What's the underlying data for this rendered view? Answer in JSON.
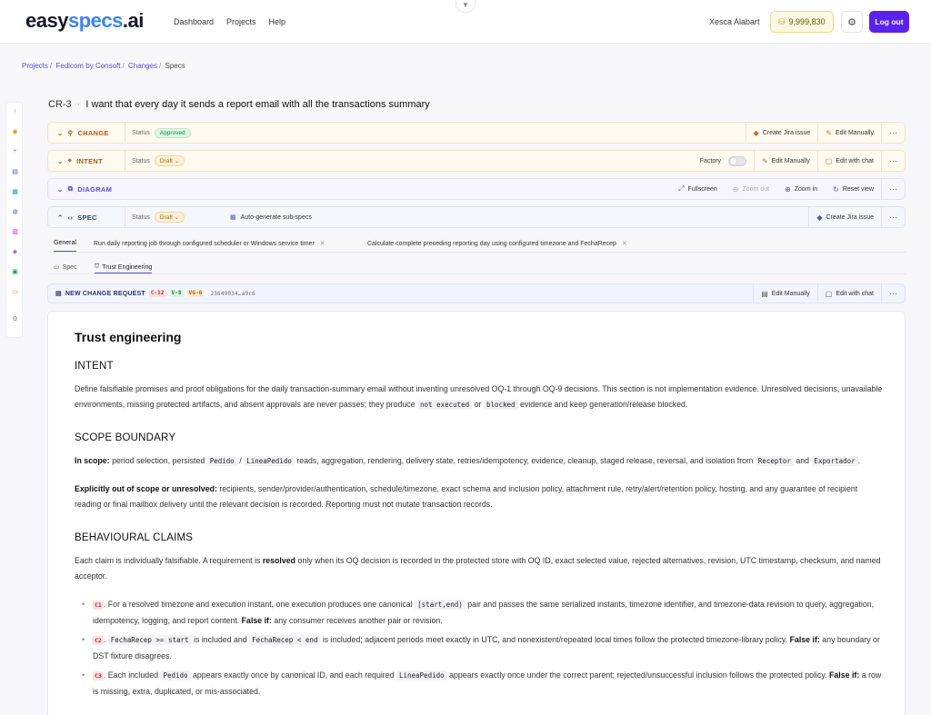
{
  "brand": {
    "part1": "easy",
    "part2": "specs",
    "part3": ".ai"
  },
  "nav": {
    "dashboard": "Dashboard",
    "projects": "Projects",
    "help": "Help"
  },
  "user": {
    "name": "Xesca Alabart",
    "credits": "9,999,830",
    "logout": "Log out"
  },
  "breadcrumb": {
    "projects": "Projects",
    "project": "Fedicom by Consoft",
    "changes": "Changes",
    "current": "Specs"
  },
  "title": {
    "id": "CR-3",
    "text": "I want that every day it sends a report email with all the transactions summary"
  },
  "sections": {
    "change": {
      "label": "CHANGE",
      "status_label": "Status",
      "status": "Approved",
      "actions": [
        "Create Jira issue",
        "Edit Manually"
      ]
    },
    "intent": {
      "label": "INTENT",
      "status_label": "Status",
      "status": "Draft",
      "factory": "Factory",
      "actions": [
        "Edit Manually",
        "Edit with chat"
      ]
    },
    "diagram": {
      "label": "DIAGRAM",
      "actions": [
        "Fullscreen",
        "Zoom out",
        "Zoom in",
        "Reset view"
      ]
    },
    "spec": {
      "label": "SPEC",
      "status_label": "Status",
      "status": "Draft",
      "auto": "Auto-generate sub-specs",
      "actions": [
        "Create Jira issue"
      ]
    }
  },
  "tabs": [
    "General",
    "Run daily reporting job through configured scheduler or Windows service timer",
    "Calculate complete preceding reporting day using configured timezone and FechaRecep"
  ],
  "subtabs": [
    "Spec",
    "Trust Engineering"
  ],
  "ncr": {
    "label": "NEW CHANGE REQUEST",
    "tags": [
      "C-12",
      "V-8",
      "VG-6"
    ],
    "hash": "23649034…a9c6",
    "actions": [
      "Edit Manually",
      "Edit with chat"
    ]
  },
  "doc": {
    "title": "Trust engineering",
    "intent_h": "INTENT",
    "intent_p1": "Define falsifiable promises and proof obligations for the daily transaction-summary email without inventing unresolved OQ-1 through OQ-9 decisions. This section is not implementation evidence. Unresolved decisions, unavailable environments, missing protected artifacts, and absent approvals are never passes; they produce",
    "intent_code1": "not executed",
    "intent_or": "or",
    "intent_code2": "blocked",
    "intent_p2": "evidence and keep generation/release blocked.",
    "scope_h": "SCOPE BOUNDARY",
    "inscope_b": "In scope:",
    "inscope_t1": "period selection, persisted",
    "inscope_c1": "Pedido",
    "inscope_slash": "/",
    "inscope_c2": "LineaPedido",
    "inscope_t2": "reads, aggregation, rendering, delivery state, retries/idempotency, evidence, cleanup, staged release, reversal, and isolation from",
    "inscope_c3": "Receptor",
    "inscope_and": "and",
    "inscope_c4": "Exportador",
    "inscope_end": ".",
    "out_b": "Explicitly out of scope or unresolved:",
    "out_t": "recipients, sender/provider/authentication, schedule/timezone, exact schema and inclusion policy, attachment rule, retry/alert/retention policy, hosting, and any guarantee of recipient reading or final mailbox delivery until the relevant decision is recorded. Reporting must not mutate transaction records.",
    "claims_h": "BEHAVIOURAL CLAIMS",
    "claims_t1": "Each claim is individually falsifiable. A requirement is",
    "claims_b": "resolved",
    "claims_t2": "only when its OQ decision is recorded in the protected store with OQ ID, exact selected value, rejected alternatives, revision, UTC timestamp, checksum, and named acceptor.",
    "c1": {
      "id": "C1",
      "t1": ". For a resolved timezone and execution instant, one execution produces one canonical",
      "code": "[start,end)",
      "t2": "pair and passes the same serialized instants, timezone identifier, and timezone-data revision to query, aggregation, idempotency, logging, and report content.",
      "fb": "False if:",
      "ft": "any consumer receives another pair or revision."
    },
    "c2": {
      "id": "C2",
      "dot": ".",
      "code1": "FechaRecep >= start",
      "t1": "is included and",
      "code2": "FechaRecep < end",
      "t2": "is included; adjacent periods meet exactly in UTC, and nonexistent/repeated local times follow the protected timezone-library policy.",
      "fb": "False if:",
      "ft": "any boundary or DST fixture disagrees."
    },
    "c3": {
      "id": "C3",
      "t1": ". Each included",
      "code1": "Pedido",
      "t2": "appears exactly once by canonical ID, and each required",
      "code2": "LineaPedido",
      "t3": "appears exactly once under the correct parent; rejected/unsuccessful inclusion follows the protected policy.",
      "fb": "False if:",
      "ft": "a row is missing, extra, duplicated, or mis-associated."
    }
  }
}
